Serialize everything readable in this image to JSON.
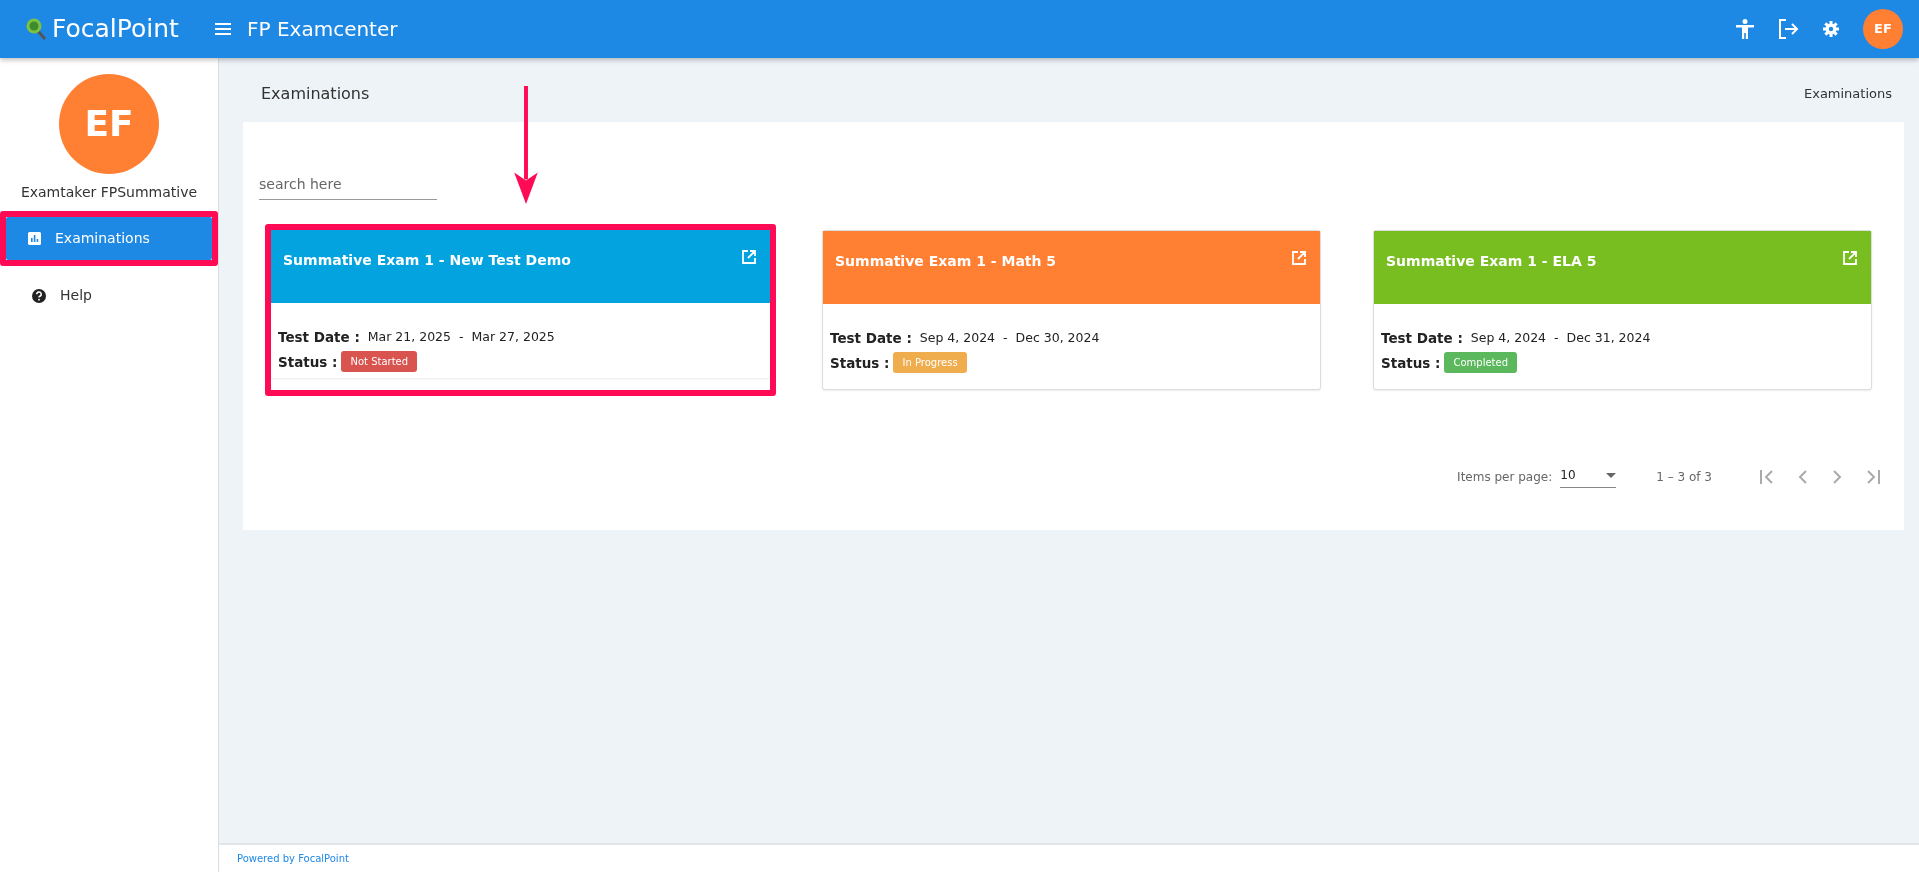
{
  "header": {
    "logo": "FocalPoint",
    "title": "FP Examcenter",
    "avatar": "EF"
  },
  "sidebar": {
    "avatar": "EF",
    "user_name": "Examtaker FPSummative",
    "items": [
      {
        "label": "Examinations",
        "kind": "chart",
        "selected": true,
        "highlighted": true
      },
      {
        "label": "Help",
        "kind": "help",
        "selected": false,
        "highlighted": false
      }
    ]
  },
  "page": {
    "title": "Examinations",
    "breadcrumb": "Examinations"
  },
  "search": {
    "placeholder": "search here"
  },
  "annotation_arrow": true,
  "exams": [
    {
      "title": "Summative Exam 1 - New Test Demo",
      "color": "#03a3e0",
      "highlighted": true,
      "date_label": "Test Date :",
      "start": "Mar 21, 2025",
      "separator": "-",
      "end": "Mar 27, 2025",
      "status_label": "Status :",
      "status": {
        "text": "Not Started",
        "kind": "not_started"
      }
    },
    {
      "title": "Summative Exam 1 - Math 5",
      "color": "#ff7f33",
      "highlighted": false,
      "date_label": "Test Date :",
      "start": "Sep 4, 2024",
      "separator": "-",
      "end": "Dec 30, 2024",
      "status_label": "Status :",
      "status": {
        "text": "In Progress",
        "kind": "in_progress"
      }
    },
    {
      "title": "Summative Exam 1 - ELA 5",
      "color": "#78be20",
      "highlighted": false,
      "date_label": "Test Date :",
      "start": "Sep 4, 2024",
      "separator": "-",
      "end": "Dec 31, 2024",
      "status_label": "Status :",
      "status": {
        "text": "Completed",
        "kind": "completed"
      }
    }
  ],
  "paginator": {
    "label": "Items per page:",
    "page_size": "10",
    "range": "1 – 3 of 3"
  },
  "footer": {
    "text": "Powered by FocalPoint"
  }
}
